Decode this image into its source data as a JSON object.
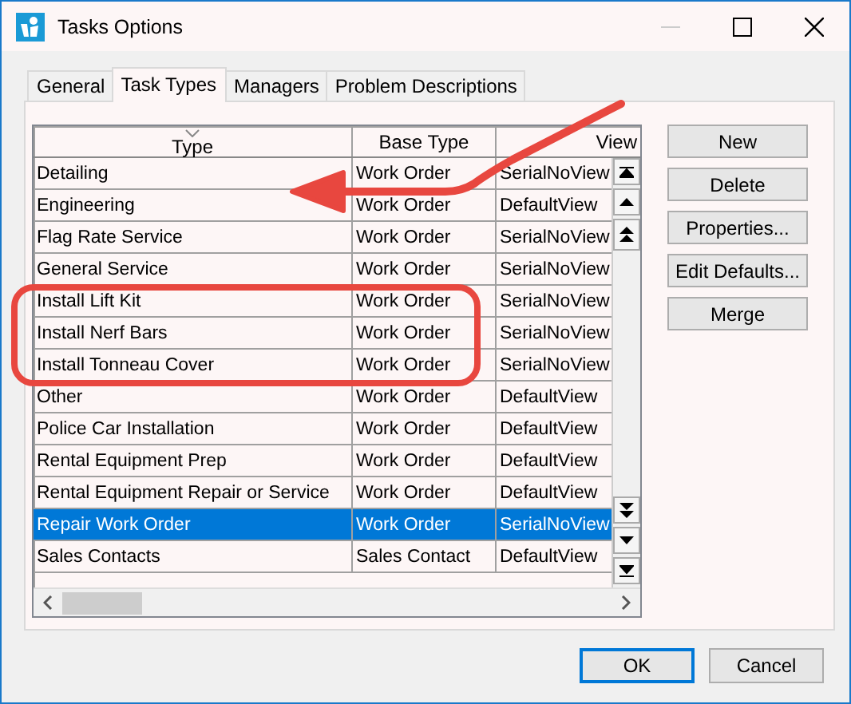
{
  "window": {
    "title": "Tasks Options"
  },
  "tabs": [
    {
      "label": "General",
      "selected": false
    },
    {
      "label": "Task Types",
      "selected": true
    },
    {
      "label": "Managers",
      "selected": false
    },
    {
      "label": "Problem Descriptions",
      "selected": false
    }
  ],
  "table": {
    "columns": [
      "Type",
      "Base Type",
      "View"
    ],
    "rows": [
      {
        "cells": [
          "Detailing",
          "Work Order",
          "SerialNoView"
        ],
        "selected": false
      },
      {
        "cells": [
          "Engineering",
          "Work Order",
          "DefaultView"
        ],
        "selected": false
      },
      {
        "cells": [
          "Flag Rate Service",
          "Work Order",
          "SerialNoView"
        ],
        "selected": false
      },
      {
        "cells": [
          "General Service",
          "Work Order",
          "SerialNoView"
        ],
        "selected": false
      },
      {
        "cells": [
          "Install Lift Kit",
          "Work Order",
          "SerialNoView"
        ],
        "selected": false
      },
      {
        "cells": [
          "Install Nerf Bars",
          "Work Order",
          "SerialNoView"
        ],
        "selected": false
      },
      {
        "cells": [
          "Install Tonneau Cover",
          "Work Order",
          "SerialNoView"
        ],
        "selected": false
      },
      {
        "cells": [
          "Other",
          "Work Order",
          "DefaultView"
        ],
        "selected": false
      },
      {
        "cells": [
          "Police Car Installation",
          "Work Order",
          "DefaultView"
        ],
        "selected": false
      },
      {
        "cells": [
          "Rental Equipment Prep",
          "Work Order",
          "DefaultView"
        ],
        "selected": false
      },
      {
        "cells": [
          "Rental Equipment Repair or Service",
          "Work Order",
          "DefaultView"
        ],
        "selected": false
      },
      {
        "cells": [
          "Repair Work Order",
          "Work Order",
          "SerialNoView"
        ],
        "selected": true
      },
      {
        "cells": [
          "Sales Contacts",
          "Sales Contact",
          "DefaultView"
        ],
        "selected": false
      }
    ]
  },
  "side_buttons": [
    "New",
    "Delete",
    "Properties...",
    "Edit Defaults...",
    "Merge"
  ],
  "buttons": [
    {
      "label": "OK",
      "default": true
    },
    {
      "label": "Cancel",
      "default": false
    }
  ]
}
